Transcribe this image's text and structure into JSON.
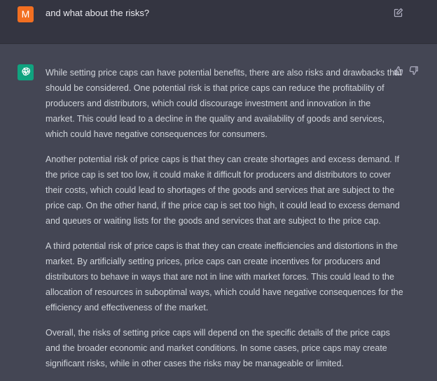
{
  "user_message": {
    "avatar_letter": "M",
    "text": "and what about the risks?"
  },
  "assistant_message": {
    "paragraphs": [
      [
        "While setting price caps can have potential benefits, there are also risks and drawbacks that",
        "should be considered. One potential risk is that price caps can reduce the profitability of",
        "producers and distributors, which could discourage investment and innovation in the",
        "market. This could lead to a decline in the quality and availability of goods and services,",
        "which could have negative consequences for consumers."
      ],
      [
        "Another potential risk of price caps is that they can create shortages and excess demand. If",
        "the price cap is set too low, it could make it difficult for producers and distributors to cover",
        "their costs, which could lead to shortages of the goods and services that are subject to the",
        "price cap. On the other hand, if the price cap is set too high, it could lead to excess demand",
        "and queues or waiting lists for the goods and services that are subject to the price cap."
      ],
      [
        "A third potential risk of price caps is that they can create inefficiencies and distortions in the",
        "market. By artificially setting prices, price caps can create incentives for producers and",
        "distributors to behave in ways that are not in line with market forces. This could lead to the",
        "allocation of resources in suboptimal ways, which could have negative consequences for the",
        "efficiency and effectiveness of the market."
      ],
      [
        "Overall, the risks of setting price caps will depend on the specific details of the price caps",
        "and the broader economic and market conditions. In some cases, price caps may create",
        "significant risks, while in other cases the risks may be manageable or limited."
      ]
    ]
  },
  "icons": {
    "user_avatar": "user-avatar-icon",
    "assistant_avatar": "openai-logo-icon",
    "edit": "edit-icon",
    "thumbs_up": "thumbs-up-icon",
    "thumbs_down": "thumbs-down-icon"
  },
  "colors": {
    "user_avatar_bg": "#f26f21",
    "assistant_avatar_bg": "#10a37f",
    "user_row_bg": "#343541",
    "assistant_row_bg": "#444654",
    "text": "#d1d5db"
  }
}
